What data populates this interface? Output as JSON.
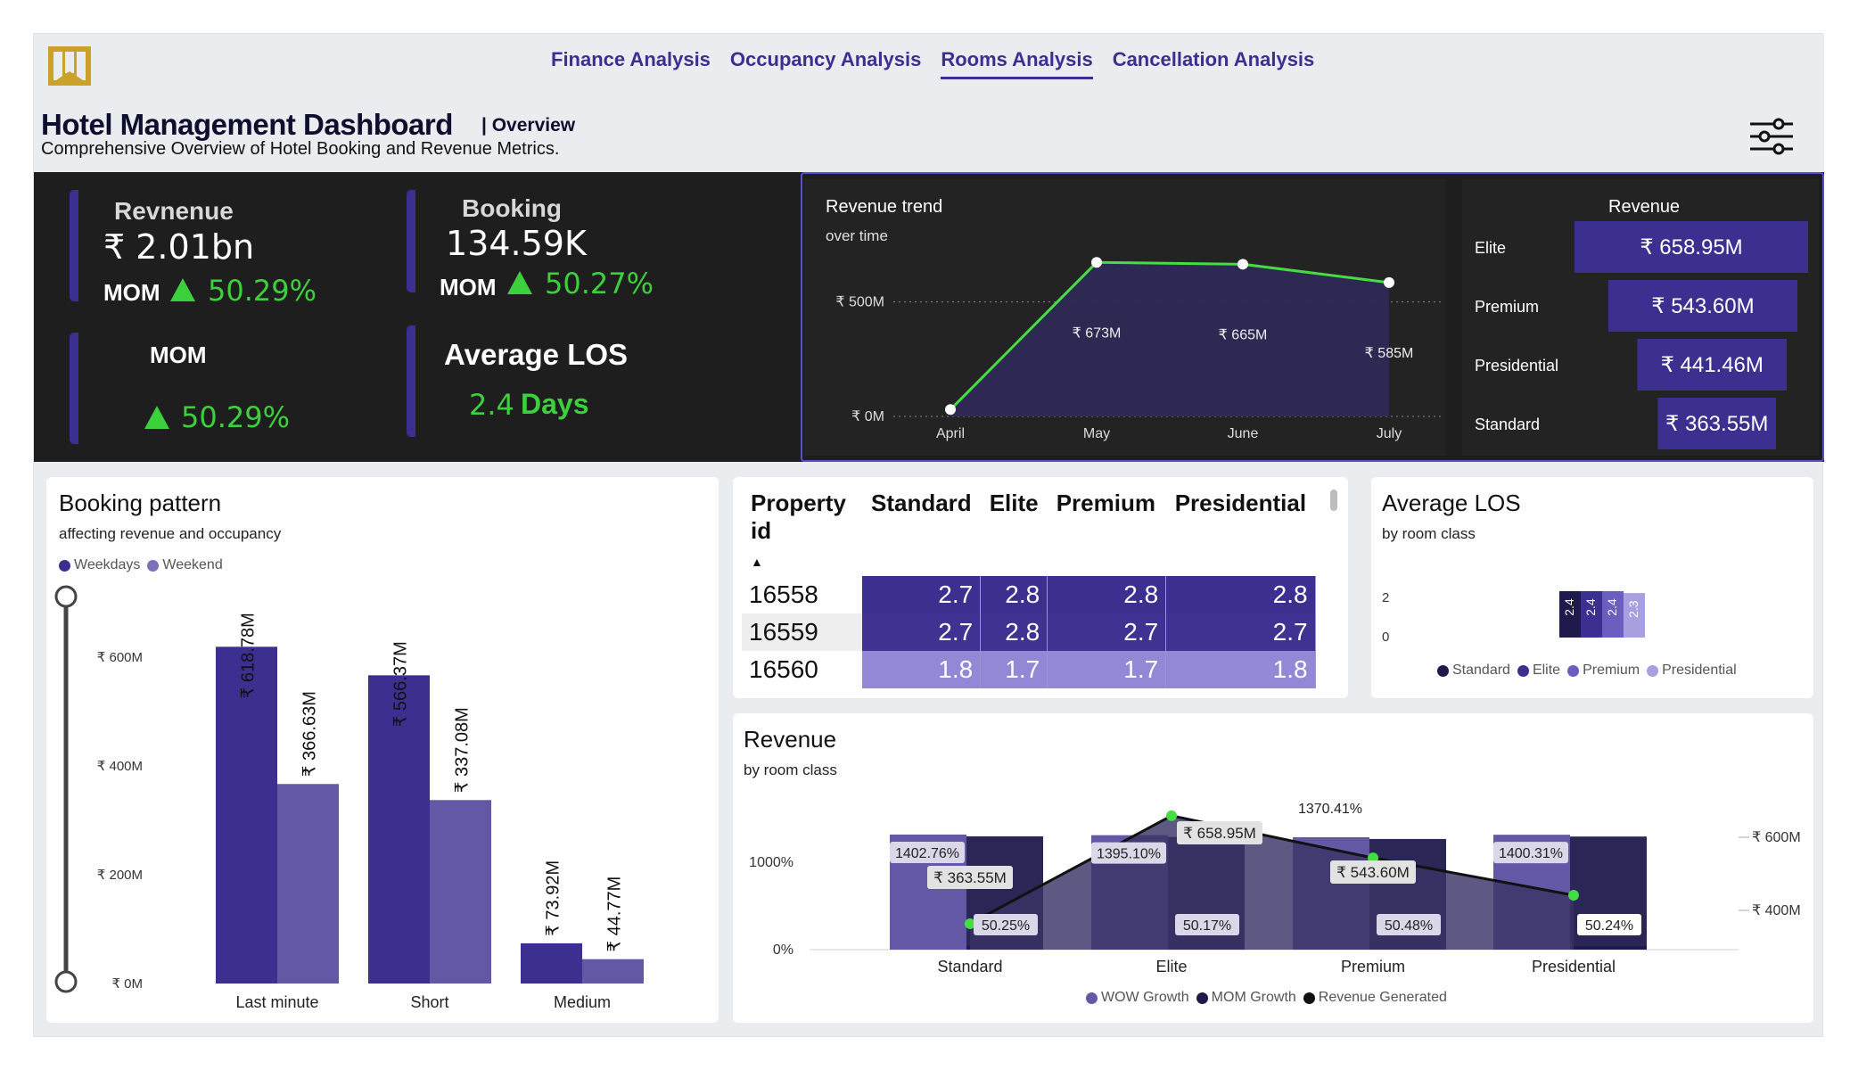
{
  "nav": {
    "items": [
      {
        "label": "Finance Analysis",
        "active": false
      },
      {
        "label": "Occupancy Analysis",
        "active": false
      },
      {
        "label": "Rooms Analysis",
        "active": true
      },
      {
        "label": "Cancellation Analysis",
        "active": false
      }
    ]
  },
  "header": {
    "title": "Hotel Management Dashboard",
    "tag": "| Overview",
    "description": "Comprehensive Overview of Hotel Booking and Revenue Metrics."
  },
  "kpis": {
    "revenue": {
      "label": "Revnenue",
      "value": "₹ 2.01bn",
      "mom_label": "MOM",
      "mom_value": "50.29%"
    },
    "booking": {
      "label": "Booking",
      "value": "134.59K",
      "mom_label": "MOM",
      "mom_value": "50.27%"
    },
    "mom": {
      "label": "MOM",
      "value": "50.29%"
    },
    "avg_los": {
      "label": "Average LOS",
      "value": "2.4",
      "unit": "Days"
    }
  },
  "revenue_trend": {
    "title": "Revenue trend",
    "subtitle": "over time",
    "y_ticks": [
      "₹ 500M",
      "₹ 0M"
    ],
    "labels": [
      "₹ 673M",
      "₹ 665M",
      "₹ 585M"
    ]
  },
  "revenue_by_class": {
    "title": "Revenue",
    "rows": [
      {
        "label": "Elite",
        "value": "₹ 658.95M",
        "num": 658.95
      },
      {
        "label": "Premium",
        "value": "₹ 543.60M",
        "num": 543.6
      },
      {
        "label": "Presidential",
        "value": "₹ 441.46M",
        "num": 441.46
      },
      {
        "label": "Standard",
        "value": "₹ 363.55M",
        "num": 363.55
      }
    ]
  },
  "booking_pattern": {
    "title": "Booking pattern",
    "subtitle": "affecting revenue and occupancy",
    "legend": [
      "Weekdays",
      "Weekend"
    ],
    "y_ticks": [
      "₹ 600M",
      "₹ 400M",
      "₹ 200M",
      "₹ 0M"
    ],
    "value_labels": [
      [
        "₹ 618.78M",
        "₹ 366.63M"
      ],
      [
        "₹ 566.37M",
        "₹ 337.08M"
      ],
      [
        "₹ 73.92M",
        "₹ 44.77M"
      ]
    ]
  },
  "los_matrix": {
    "headers": [
      "Property id",
      "Standard",
      "Elite",
      "Premium",
      "Presidential"
    ],
    "rows": [
      {
        "id": "16558",
        "values": [
          "2.7",
          "2.8",
          "2.8",
          "2.8"
        ],
        "shade": "#3b2f8f"
      },
      {
        "id": "16559",
        "values": [
          "2.7",
          "2.8",
          "2.7",
          "2.7"
        ],
        "shade": "#3f3292"
      },
      {
        "id": "16560",
        "values": [
          "1.8",
          "1.7",
          "1.7",
          "1.8"
        ],
        "shade": "#9288d6"
      }
    ]
  },
  "avg_los_chart": {
    "title": "Average LOS",
    "subtitle": "by room class",
    "y_ticks": [
      "2",
      "0"
    ],
    "value_labels": [
      "2.4",
      "2.4",
      "2.4",
      "2.3"
    ],
    "legend": [
      "Standard",
      "Elite",
      "Premium",
      "Presidential"
    ]
  },
  "revenue_room_chart": {
    "title": "Revenue",
    "subtitle": "by room class",
    "left_ticks": [
      "1000%",
      "0%"
    ],
    "right_ticks": [
      "₹ 600M",
      "₹ 400M"
    ],
    "wow_labels": [
      "1402.76%",
      "1395.10%",
      "1370.41%",
      "1400.31%"
    ],
    "mom_labels": [
      "50.25%",
      "50.17%",
      "50.48%",
      "50.24%"
    ],
    "revenue_labels": [
      "₹ 363.55M",
      "₹ 658.95M",
      "₹ 543.60M"
    ],
    "legend": [
      "WOW Growth",
      "MOM Growth",
      "Revenue Generated"
    ]
  },
  "chart_data": [
    {
      "type": "line",
      "title": "Revenue trend",
      "subtitle": "over time",
      "x": [
        "April",
        "May",
        "June",
        "July"
      ],
      "series": [
        {
          "values": [
            30,
            673,
            665,
            585
          ]
        }
      ],
      "ylim": [
        0,
        900
      ],
      "y_ticks": [
        "₹ 500M",
        "₹ 0M"
      ],
      "color": "#44dd44"
    },
    {
      "type": "bar",
      "title": "Revenue",
      "categories": [
        "Elite",
        "Premium",
        "Presidential",
        "Standard"
      ],
      "values": [
        658.95,
        543.6,
        441.46,
        363.55
      ]
    },
    {
      "type": "bar",
      "title": "Booking pattern",
      "subtitle": "affecting revenue and occupancy",
      "categories": [
        "Last minute",
        "Short",
        "Medium"
      ],
      "series": [
        {
          "name": "Weekdays",
          "values": [
            618.78,
            566.37,
            73.92
          ],
          "color": "#3b2f8f"
        },
        {
          "name": "Weekend",
          "values": [
            366.63,
            337.08,
            44.77
          ],
          "color": "#6358a6"
        }
      ],
      "ylim": [
        0,
        650
      ],
      "y_ticks": [
        "₹ 600M",
        "₹ 400M",
        "₹ 200M",
        "₹ 0M"
      ]
    },
    {
      "type": "table",
      "columns": [
        "Property id",
        "Standard",
        "Elite",
        "Premium",
        "Presidential"
      ],
      "rows": [
        [
          "16558",
          2.7,
          2.8,
          2.8,
          2.8
        ],
        [
          "16559",
          2.7,
          2.8,
          2.7,
          2.7
        ],
        [
          "16560",
          1.8,
          1.7,
          1.7,
          1.8
        ]
      ]
    },
    {
      "type": "bar",
      "title": "Average LOS",
      "subtitle": "by room class",
      "categories": [
        "Standard",
        "Elite",
        "Premium",
        "Presidential"
      ],
      "values": [
        2.4,
        2.4,
        2.4,
        2.3
      ],
      "colors": [
        "#1f1a4d",
        "#3b2f8f",
        "#6a5fc0",
        "#a69fe0"
      ],
      "ylim": [
        0,
        3
      ]
    },
    {
      "type": "bar",
      "title": "Revenue",
      "subtitle": "by room class",
      "categories": [
        "Standard",
        "Elite",
        "Premium",
        "Presidential"
      ],
      "series": [
        {
          "name": "WOW Growth",
          "values": [
            1402.76,
            1395.1,
            1370.41,
            1400.31
          ],
          "color": "#6358a6"
        },
        {
          "name": "MOM Growth",
          "values": [
            50.25,
            50.17,
            50.48,
            50.24
          ],
          "color": "#1f1a4d"
        },
        {
          "name": "Revenue Generated",
          "values": [
            363.55,
            658.95,
            543.6,
            441.46
          ],
          "color": "#111111"
        }
      ],
      "left_ticks": [
        "1000%",
        "0%"
      ],
      "right_ticks": [
        "₹ 600M",
        "₹ 400M"
      ]
    }
  ]
}
